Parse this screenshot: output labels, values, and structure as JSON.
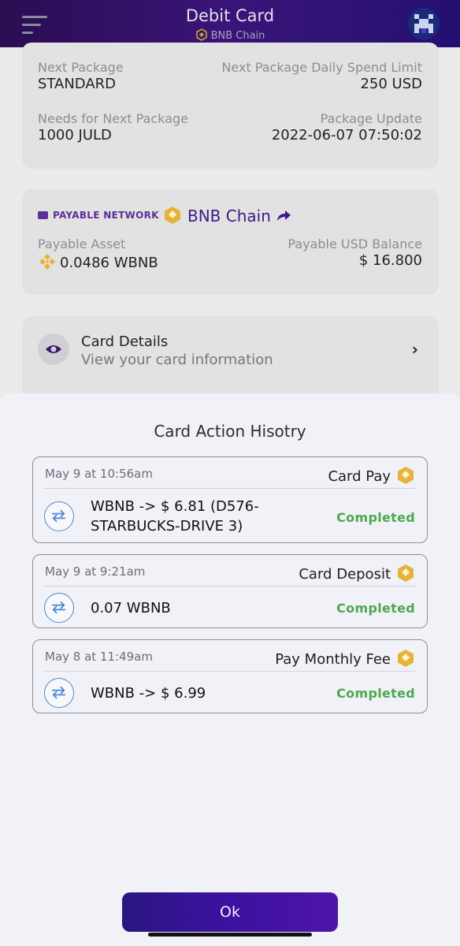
{
  "header": {
    "title": "Debit Card",
    "subtitle": "BNB Chain"
  },
  "package_card": {
    "next_package_label": "Next Package",
    "next_package_value": "STANDARD",
    "daily_limit_label": "Next Package Daily Spend Limit",
    "daily_limit_value": "250 USD",
    "needs_label": "Needs for Next Package",
    "needs_value": "1000 JULD",
    "update_label": "Package Update",
    "update_value": "2022-06-07 07:50:02"
  },
  "network_card": {
    "badge": "PAYABLE NETWORK",
    "chain": "BNB Chain",
    "asset_label": "Payable Asset",
    "asset_value": "0.0486 WBNB",
    "balance_label": "Payable USD Balance",
    "balance_value": "$ 16.800"
  },
  "details_card": {
    "title": "Card Details",
    "subtitle": "View your card information"
  },
  "sheet": {
    "title": "Card Action Hisotry",
    "ok_label": "Ok",
    "history": [
      {
        "date": "May 9 at 10:56am",
        "type": "Card Pay",
        "detail_line1": "WBNB -> $ 6.81 (D576-",
        "detail_line2": "STARBUCKS-DRIVE 3)",
        "status": "Completed"
      },
      {
        "date": "May 9 at 9:21am",
        "type": "Card Deposit",
        "detail_line1": "0.07 WBNB",
        "detail_line2": "",
        "status": "Completed"
      },
      {
        "date": "May 8 at 11:49am",
        "type": "Pay Monthly Fee",
        "detail_line1": "WBNB -> $ 6.99",
        "detail_line2": "",
        "status": "Completed"
      }
    ]
  },
  "colors": {
    "accent": "#3e1a86",
    "status_completed": "#4ea84e",
    "bnb_gold": "#e6b33a"
  },
  "icons": [
    "menu-icon",
    "bnb-icon",
    "avatar-icon",
    "id-card-icon",
    "share-arrow-icon",
    "eye-icon",
    "chevron-right-icon",
    "swap-icon"
  ]
}
